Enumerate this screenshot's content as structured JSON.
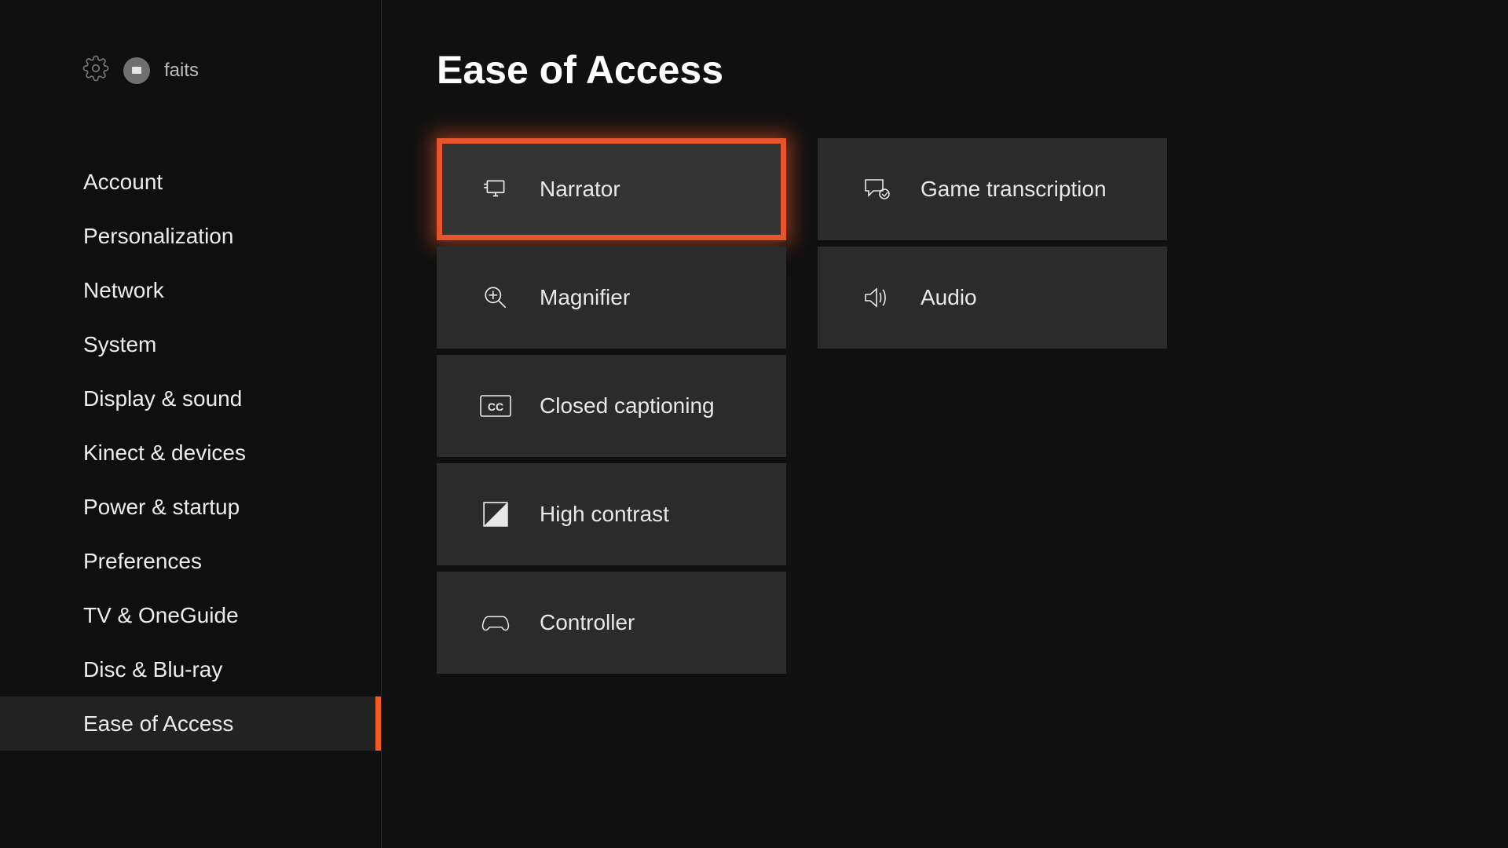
{
  "header": {
    "profile_name": "faits",
    "page_title": "Ease of Access"
  },
  "sidebar": {
    "items": [
      "Account",
      "Personalization",
      "Network",
      "System",
      "Display & sound",
      "Kinect & devices",
      "Power & startup",
      "Preferences",
      "TV & OneGuide",
      "Disc & Blu-ray",
      "Ease of Access"
    ],
    "active_index": 10
  },
  "tiles": {
    "col1": [
      "Narrator",
      "Magnifier",
      "Closed captioning",
      "High contrast",
      "Controller"
    ],
    "col2": [
      "Game transcription",
      "Audio"
    ],
    "focused": "Narrator"
  }
}
